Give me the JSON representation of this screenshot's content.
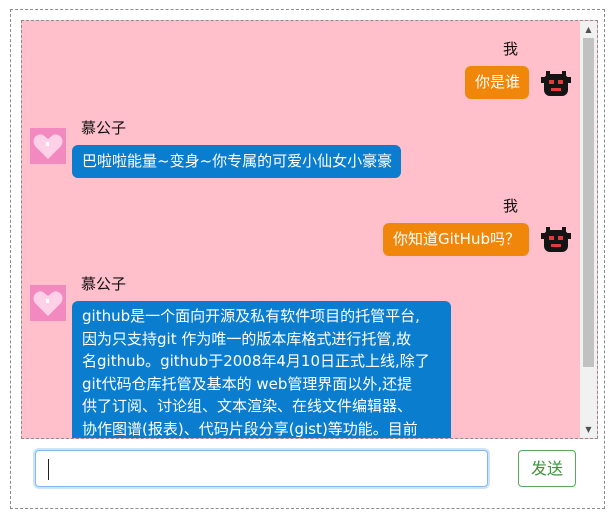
{
  "chat": {
    "messages": [
      {
        "sender": "me",
        "name": "我",
        "text": "你是谁",
        "avatar_icon": "black-monster-icon"
      },
      {
        "sender": "other",
        "name": "慕公子",
        "text": "巴啦啦能量~变身~你专属的可爱小仙女小豪豪",
        "avatar_icon": "pink-heart-icon"
      },
      {
        "sender": "me",
        "name": "我",
        "text": "你知道GitHub吗？",
        "avatar_icon": "black-monster-icon"
      },
      {
        "sender": "other",
        "name": "慕公子",
        "text_lines": [
          "github是一个面向开源及私有软件项目的托管平台,",
          "因为只支持git 作为唯一的版本库格式进行托管,故",
          "名github。github于2008年4月10日正式上线,除了",
          "git代码仓库托管及基本的 web管理界面以外,还提",
          "供了订阅、讨论组、文本渲染、在线文件编辑器、",
          "协作图谱(报表)、代码片段分享(gist)等功能。目前"
        ],
        "avatar_icon": "pink-heart-icon"
      }
    ]
  },
  "input": {
    "value": "",
    "placeholder": ""
  },
  "send_button": {
    "label": "发送"
  },
  "colors": {
    "chat_background": "#ffc0cb",
    "my_bubble": "#f0870b",
    "other_bubble": "#0b7dce",
    "send_text": "#3d943d"
  }
}
